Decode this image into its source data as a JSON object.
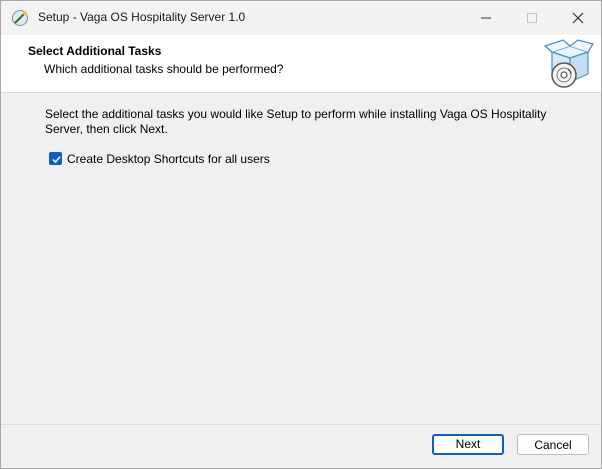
{
  "window": {
    "title": "Setup - Vaga OS Hospitality Server 1.0",
    "app_icon": "installer-wand-icon",
    "controls": {
      "minimize": "minimize-icon",
      "maximize": "maximize-icon",
      "close": "close-icon"
    }
  },
  "header": {
    "title": "Select Additional Tasks",
    "subtitle": "Which additional tasks should be performed?",
    "icon": "package-cd-icon"
  },
  "content": {
    "instructions": "Select the additional tasks you would like Setup to perform while installing Vaga OS Hospitality Server, then click Next.",
    "tasks": [
      {
        "label": "Create Desktop Shortcuts for all users",
        "checked": true
      }
    ]
  },
  "buttons": {
    "next": "Next",
    "cancel": "Cancel"
  },
  "colors": {
    "accent": "#0f5ec3",
    "header_bg": "#ffffff",
    "window_bg": "#f0f0f0"
  }
}
